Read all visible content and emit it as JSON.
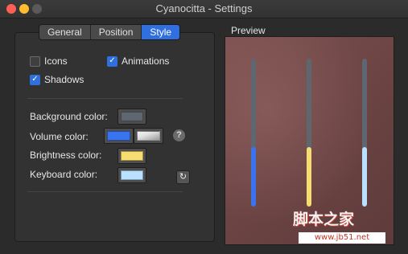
{
  "window": {
    "title": "Cyanocitta - Settings"
  },
  "tabs": [
    {
      "label": "General",
      "active": false
    },
    {
      "label": "Position",
      "active": false
    },
    {
      "label": "Style",
      "active": true
    }
  ],
  "options": {
    "icons": {
      "label": "Icons",
      "checked": false
    },
    "animations": {
      "label": "Animations",
      "checked": true
    },
    "shadows": {
      "label": "Shadows",
      "checked": true
    }
  },
  "colors": {
    "background": {
      "label": "Background color:",
      "value": "#5e6770"
    },
    "volume": {
      "label": "Volume color:",
      "value": "#3a73f0",
      "secondary": "#d8d8d8"
    },
    "brightness": {
      "label": "Brightness color:",
      "value": "#f7dc6f"
    },
    "keyboard": {
      "label": "Keyboard color:",
      "value": "#b9e0ff"
    }
  },
  "help_glyph": "?",
  "reset_glyph": "↻",
  "preview": {
    "title": "Preview",
    "bars": [
      {
        "name": "volume",
        "level": 0.4,
        "color": "#3a73f0"
      },
      {
        "name": "brightness",
        "level": 0.4,
        "color": "#f7dc6f"
      },
      {
        "name": "keyboard",
        "level": 0.4,
        "color": "#b9e0ff"
      }
    ]
  },
  "watermark": {
    "text": "脚本之家",
    "url": "www.jb51.net"
  }
}
